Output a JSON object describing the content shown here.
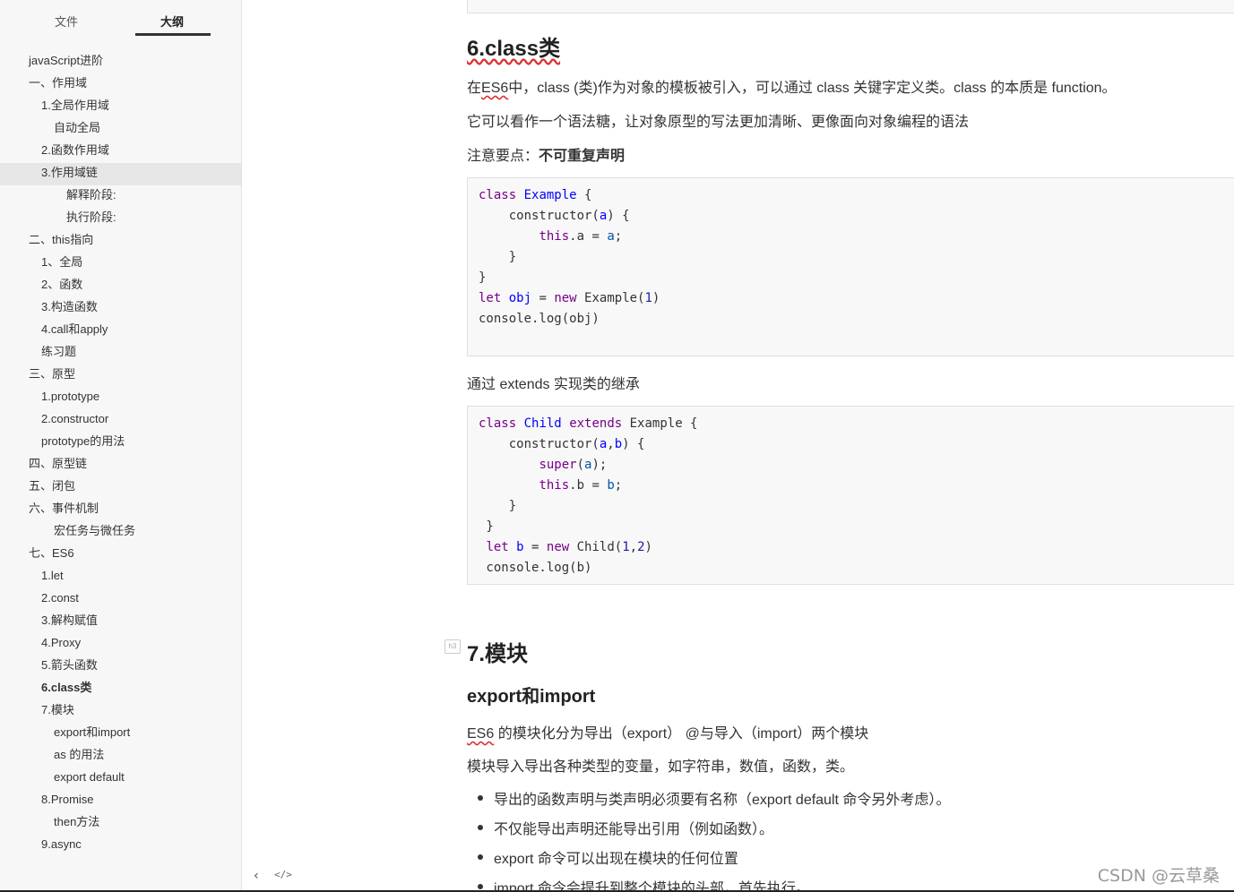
{
  "sidebar": {
    "tabs": [
      "文件",
      "大纲"
    ],
    "active_tab": "大纲",
    "outline": [
      {
        "label": "javaScript进阶",
        "level": 0
      },
      {
        "label": "一、作用域",
        "level": 1
      },
      {
        "label": "1.全局作用域",
        "level": 2
      },
      {
        "label": "自动全局",
        "level": 3
      },
      {
        "label": "2.函数作用域",
        "level": 2
      },
      {
        "label": "3.作用域链",
        "level": 2,
        "highlighted": true
      },
      {
        "label": "解释阶段:",
        "level": 4
      },
      {
        "label": "执行阶段:",
        "level": 4
      },
      {
        "label": "二、this指向",
        "level": 1
      },
      {
        "label": "1、全局",
        "level": 2
      },
      {
        "label": "2、函数",
        "level": 2
      },
      {
        "label": "3.构造函数",
        "level": 2
      },
      {
        "label": "4.call和apply",
        "level": 2
      },
      {
        "label": "练习题",
        "level": 2
      },
      {
        "label": "三、原型",
        "level": 1
      },
      {
        "label": "1.prototype",
        "level": 2
      },
      {
        "label": "2.constructor",
        "level": 2
      },
      {
        "label": "prototype的用法",
        "level": 2
      },
      {
        "label": "四、原型链",
        "level": 1
      },
      {
        "label": "五、闭包",
        "level": 1
      },
      {
        "label": "六、事件机制",
        "level": 1
      },
      {
        "label": "宏任务与微任务",
        "level": 3
      },
      {
        "label": "七、ES6",
        "level": 1
      },
      {
        "label": "1.let",
        "level": 2
      },
      {
        "label": "2.const",
        "level": 2
      },
      {
        "label": "3.解构赋值",
        "level": 2
      },
      {
        "label": "4.Proxy",
        "level": 2
      },
      {
        "label": "5.箭头函数",
        "level": 2
      },
      {
        "label": "6.class类",
        "level": 2,
        "current": true
      },
      {
        "label": "7.模块",
        "level": 2
      },
      {
        "label": "export和import",
        "level": 3
      },
      {
        "label": "as 的用法",
        "level": 3
      },
      {
        "label": "export default",
        "level": 3
      },
      {
        "label": "8.Promise",
        "level": 2
      },
      {
        "label": "then方法",
        "level": 3
      },
      {
        "label": "9.async",
        "level": 2
      }
    ],
    "footer": {
      "collapse_icon": "‹",
      "source_icon": "</>"
    }
  },
  "doc": {
    "sec6": {
      "title": "6.class类",
      "p1": "在ES6中，class (类)作为对象的模板被引入，可以通过 class 关键字定义类。class 的本质是 function。",
      "p2": "它可以看作一个语法糖，让对象原型的写法更加清晰、更像面向对象编程的语法",
      "note_prefix": "注意要点：",
      "note_bold": "不可重复声明",
      "extends_text": "通过 extends 实现类的继承"
    },
    "sec7": {
      "marker": "h3",
      "title": "7.模块",
      "subtitle": "export和import",
      "p1": "ES6 的模块化分为导出（export） @与导入（import）两个模块",
      "p2": "模块导入导出各种类型的变量，如字符串，数值，函数，类。",
      "bullets": [
        "导出的函数声明与类声明必须要有名称（export default 命令另外考虑）。",
        "不仅能导出声明还能导出引用（例如函数）。",
        "export 命令可以出现在模块的任何位置",
        "import 命令会提升到整个模块的头部，首先执行。"
      ]
    }
  },
  "watermark": "CSDN @云草桑",
  "colors": {
    "keyword": "#770088",
    "definition": "#0000ff",
    "variable": "#0055aa",
    "number": "#1a1aa6"
  }
}
